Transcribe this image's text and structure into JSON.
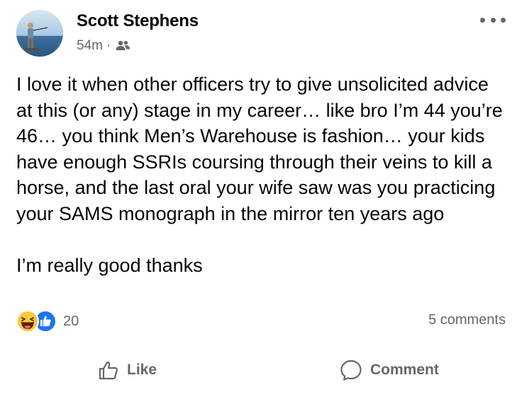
{
  "post": {
    "author_name": "Scott Stephens",
    "time_ago": "54m",
    "separator": "·",
    "audience_icon": "friends-icon",
    "more_icon": "more-horizontal-icon",
    "paragraphs": [
      "I love it when other officers try to give unsolicited advice at this (or any) stage in my career… like bro I’m 44 you’re 46… you think Men’s Warehouse is fashion… your kids have enough SSRIs coursing through their veins to kill a horse, and the last oral your wife saw was you practicing your SAMS monograph in the mirror ten years ago",
      "I’m really good thanks"
    ]
  },
  "reactions": {
    "icons": [
      "haha-icon",
      "like-reaction-icon"
    ],
    "count": "20",
    "comments_label": "5 comments"
  },
  "actions": {
    "like_label": "Like",
    "comment_label": "Comment"
  },
  "colors": {
    "text": "#050505",
    "secondary": "#65676b",
    "like_blue": "#1877f2",
    "haha_yellow": "#f7c93b"
  }
}
